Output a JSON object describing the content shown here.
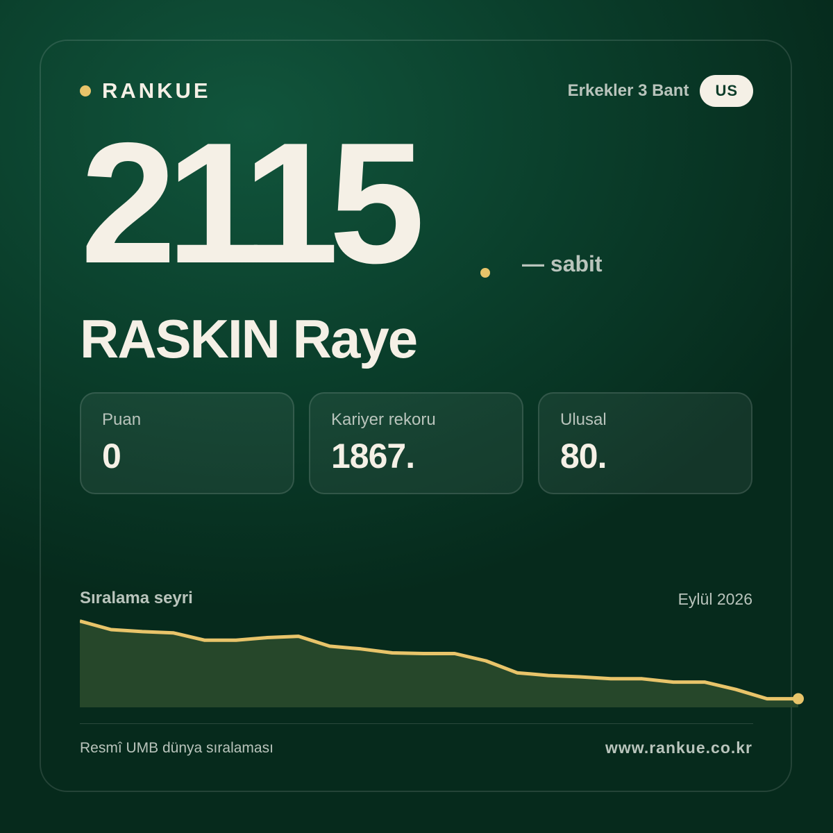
{
  "colors": {
    "accent": "#e8c46a",
    "text": "#f5f0e6",
    "muted": "#b9c4bc",
    "chart_fill": "#2a4a2c"
  },
  "brand": {
    "name": "RANKUE"
  },
  "header": {
    "category": "Erkekler 3 Bant",
    "country": "US"
  },
  "rank": {
    "value": "2115",
    "trend": "— sabit"
  },
  "player": {
    "name": "RASKIN Raye"
  },
  "stats": [
    {
      "label": "Puan",
      "value": "0"
    },
    {
      "label": "Kariyer rekoru",
      "value": "1867."
    },
    {
      "label": "Ulusal",
      "value": "80."
    }
  ],
  "history": {
    "title": "Sıralama seyri",
    "date": "Eylül 2026"
  },
  "chart_data": {
    "type": "area",
    "title": "Sıralama seyri",
    "y_inverted": true,
    "values": [
      1970,
      1983,
      1986,
      1988,
      1999,
      1999,
      1995,
      1993,
      2008,
      2012,
      2018,
      2019,
      2019,
      2030,
      2048,
      2052,
      2054,
      2057,
      2057,
      2062,
      2062,
      2073,
      2087,
      2087
    ],
    "ylim": [
      1960,
      2100
    ]
  },
  "footer": {
    "source": "Resmî UMB dünya sıralaması",
    "url": "www.rankue.co.kr"
  }
}
